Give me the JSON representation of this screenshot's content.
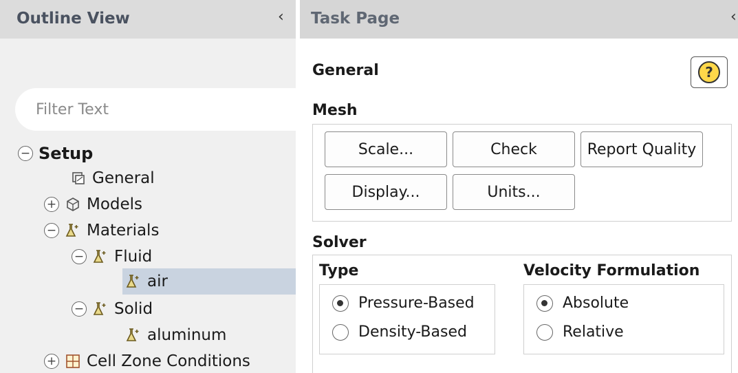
{
  "outline": {
    "title": "Outline View",
    "collapse_glyph": "‹",
    "filter_placeholder": "Filter Text",
    "tree": {
      "setup": {
        "label": "Setup",
        "toggle": "−"
      },
      "general": {
        "label": "General"
      },
      "models": {
        "label": "Models",
        "toggle": "+"
      },
      "materials": {
        "label": "Materials",
        "toggle": "−"
      },
      "fluid": {
        "label": "Fluid",
        "toggle": "−"
      },
      "air": {
        "label": "air"
      },
      "solid": {
        "label": "Solid",
        "toggle": "−"
      },
      "aluminum": {
        "label": "aluminum"
      },
      "cell_zone": {
        "label": "Cell Zone Conditions",
        "toggle": "+"
      }
    }
  },
  "task": {
    "title": "Task Page",
    "collapse_glyph": "‹",
    "page_heading": "General",
    "help_glyph": "?",
    "mesh": {
      "title": "Mesh",
      "buttons": {
        "scale": "Scale...",
        "check": "Check",
        "report_quality": "Report Quality",
        "display": "Display...",
        "units": "Units..."
      }
    },
    "solver": {
      "title": "Solver",
      "type": {
        "title": "Type",
        "options": [
          "Pressure-Based",
          "Density-Based"
        ],
        "selected": "Pressure-Based"
      },
      "velocity": {
        "title": "Velocity Formulation",
        "options": [
          "Absolute",
          "Relative"
        ],
        "selected": "Absolute"
      }
    }
  },
  "colors": {
    "selection": "#c9d3e0",
    "header_bg": "#d6d6d6",
    "material_icon": "#7a6a2a",
    "help_fill": "#ffd84a"
  }
}
